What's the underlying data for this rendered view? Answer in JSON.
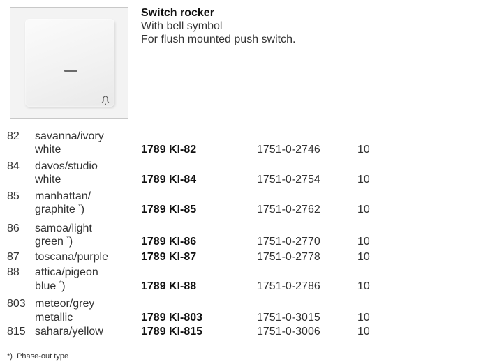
{
  "product": {
    "title": "Switch rocker",
    "line1": "With bell symbol",
    "line2": "For flush mounted push switch."
  },
  "rows": [
    {
      "num": "82",
      "color1": "savanna/ivory",
      "color2": "white",
      "mark": "",
      "article": "1789 KI-82",
      "code": "1751-0-2746",
      "qty": "10"
    },
    {
      "num": "84",
      "color1": "davos/studio",
      "color2": "white",
      "mark": "",
      "article": "1789 KI-84",
      "code": "1751-0-2754",
      "qty": "10"
    },
    {
      "num": "85",
      "color1": "manhattan/",
      "color2": "graphite",
      "mark": "*",
      "article": "1789 KI-85",
      "code": "1751-0-2762",
      "qty": "10"
    },
    {
      "num": "86",
      "color1": "samoa/light",
      "color2": "green",
      "mark": "*",
      "article": "1789 KI-86",
      "code": "1751-0-2770",
      "qty": "10"
    },
    {
      "num": "87",
      "color1": "toscana/purple",
      "color2": "",
      "mark": "",
      "article": "1789 KI-87",
      "code": "1751-0-2778",
      "qty": "10"
    },
    {
      "num": "88",
      "color1": "attica/pigeon",
      "color2": "blue",
      "mark": "*",
      "article": "1789 KI-88",
      "code": "1751-0-2786",
      "qty": "10"
    },
    {
      "num": "803",
      "color1": "meteor/grey",
      "color2": "metallic",
      "mark": "",
      "article": "1789 KI-803",
      "code": "1751-0-3015",
      "qty": "10"
    },
    {
      "num": "815",
      "color1": "sahara/yellow",
      "color2": "",
      "mark": "",
      "article": "1789 KI-815",
      "code": "1751-0-3006",
      "qty": "10"
    }
  ],
  "footnote": {
    "mark": "*",
    "paren": ")",
    "text": "Phase-out type"
  }
}
